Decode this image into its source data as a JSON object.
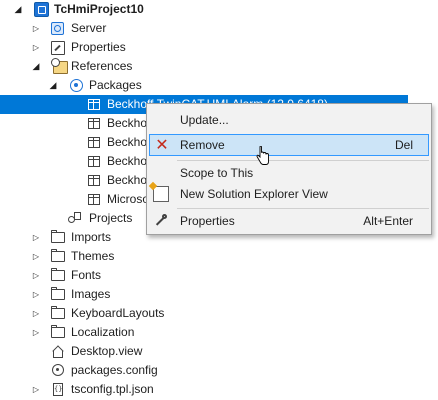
{
  "tree": {
    "root": "TcHmiProject10",
    "server": "Server",
    "properties": "Properties",
    "references": "References",
    "packages": "Packages",
    "package_items": [
      "Beckhoff.TwinCAT.HMI.Alarm (12.0.6418)",
      "Beckho",
      "Beckho",
      "Beckho",
      "Beckho",
      "Microso"
    ],
    "projects": "Projects",
    "folders": [
      "Imports",
      "Themes",
      "Fonts",
      "Images",
      "KeyboardLayouts",
      "Localization"
    ],
    "files": [
      "Desktop.view",
      "packages.config",
      "tsconfig.tpl.json"
    ]
  },
  "context_menu": {
    "items": [
      {
        "label": "Update...",
        "shortcut": "",
        "icon": "none"
      },
      {
        "label": "Remove",
        "shortcut": "Del",
        "icon": "x-icon"
      },
      {
        "label": "Scope to This",
        "shortcut": "",
        "icon": "none"
      },
      {
        "label": "New Solution Explorer View",
        "shortcut": "",
        "icon": "new-view-icon"
      },
      {
        "label": "Properties",
        "shortcut": "Alt+Enter",
        "icon": "wrench-icon"
      }
    ]
  },
  "colors": {
    "selection": "#0078d7",
    "menu_hover": "#cce4f7",
    "menu_hover_border": "#3399ff",
    "remove_icon": "#c42b1c"
  }
}
